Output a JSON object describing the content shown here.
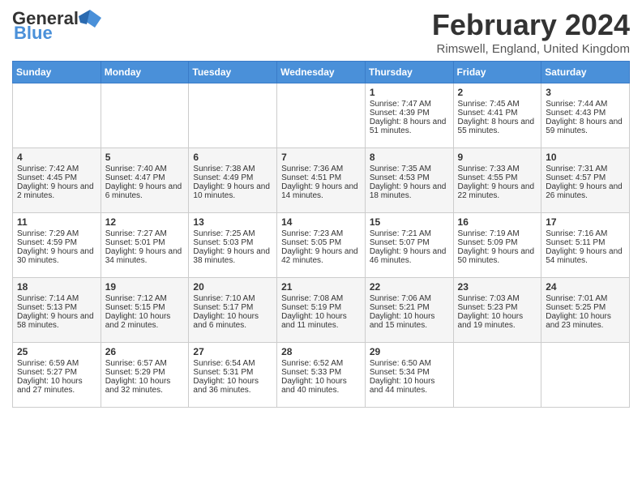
{
  "header": {
    "logo_general": "General",
    "logo_blue": "Blue",
    "month_title": "February 2024",
    "location": "Rimswell, England, United Kingdom"
  },
  "weekdays": [
    "Sunday",
    "Monday",
    "Tuesday",
    "Wednesday",
    "Thursday",
    "Friday",
    "Saturday"
  ],
  "weeks": [
    [
      {
        "day": "",
        "sunrise": "",
        "sunset": "",
        "daylight": ""
      },
      {
        "day": "",
        "sunrise": "",
        "sunset": "",
        "daylight": ""
      },
      {
        "day": "",
        "sunrise": "",
        "sunset": "",
        "daylight": ""
      },
      {
        "day": "",
        "sunrise": "",
        "sunset": "",
        "daylight": ""
      },
      {
        "day": "1",
        "sunrise": "Sunrise: 7:47 AM",
        "sunset": "Sunset: 4:39 PM",
        "daylight": "Daylight: 8 hours and 51 minutes."
      },
      {
        "day": "2",
        "sunrise": "Sunrise: 7:45 AM",
        "sunset": "Sunset: 4:41 PM",
        "daylight": "Daylight: 8 hours and 55 minutes."
      },
      {
        "day": "3",
        "sunrise": "Sunrise: 7:44 AM",
        "sunset": "Sunset: 4:43 PM",
        "daylight": "Daylight: 8 hours and 59 minutes."
      }
    ],
    [
      {
        "day": "4",
        "sunrise": "Sunrise: 7:42 AM",
        "sunset": "Sunset: 4:45 PM",
        "daylight": "Daylight: 9 hours and 2 minutes."
      },
      {
        "day": "5",
        "sunrise": "Sunrise: 7:40 AM",
        "sunset": "Sunset: 4:47 PM",
        "daylight": "Daylight: 9 hours and 6 minutes."
      },
      {
        "day": "6",
        "sunrise": "Sunrise: 7:38 AM",
        "sunset": "Sunset: 4:49 PM",
        "daylight": "Daylight: 9 hours and 10 minutes."
      },
      {
        "day": "7",
        "sunrise": "Sunrise: 7:36 AM",
        "sunset": "Sunset: 4:51 PM",
        "daylight": "Daylight: 9 hours and 14 minutes."
      },
      {
        "day": "8",
        "sunrise": "Sunrise: 7:35 AM",
        "sunset": "Sunset: 4:53 PM",
        "daylight": "Daylight: 9 hours and 18 minutes."
      },
      {
        "day": "9",
        "sunrise": "Sunrise: 7:33 AM",
        "sunset": "Sunset: 4:55 PM",
        "daylight": "Daylight: 9 hours and 22 minutes."
      },
      {
        "day": "10",
        "sunrise": "Sunrise: 7:31 AM",
        "sunset": "Sunset: 4:57 PM",
        "daylight": "Daylight: 9 hours and 26 minutes."
      }
    ],
    [
      {
        "day": "11",
        "sunrise": "Sunrise: 7:29 AM",
        "sunset": "Sunset: 4:59 PM",
        "daylight": "Daylight: 9 hours and 30 minutes."
      },
      {
        "day": "12",
        "sunrise": "Sunrise: 7:27 AM",
        "sunset": "Sunset: 5:01 PM",
        "daylight": "Daylight: 9 hours and 34 minutes."
      },
      {
        "day": "13",
        "sunrise": "Sunrise: 7:25 AM",
        "sunset": "Sunset: 5:03 PM",
        "daylight": "Daylight: 9 hours and 38 minutes."
      },
      {
        "day": "14",
        "sunrise": "Sunrise: 7:23 AM",
        "sunset": "Sunset: 5:05 PM",
        "daylight": "Daylight: 9 hours and 42 minutes."
      },
      {
        "day": "15",
        "sunrise": "Sunrise: 7:21 AM",
        "sunset": "Sunset: 5:07 PM",
        "daylight": "Daylight: 9 hours and 46 minutes."
      },
      {
        "day": "16",
        "sunrise": "Sunrise: 7:19 AM",
        "sunset": "Sunset: 5:09 PM",
        "daylight": "Daylight: 9 hours and 50 minutes."
      },
      {
        "day": "17",
        "sunrise": "Sunrise: 7:16 AM",
        "sunset": "Sunset: 5:11 PM",
        "daylight": "Daylight: 9 hours and 54 minutes."
      }
    ],
    [
      {
        "day": "18",
        "sunrise": "Sunrise: 7:14 AM",
        "sunset": "Sunset: 5:13 PM",
        "daylight": "Daylight: 9 hours and 58 minutes."
      },
      {
        "day": "19",
        "sunrise": "Sunrise: 7:12 AM",
        "sunset": "Sunset: 5:15 PM",
        "daylight": "Daylight: 10 hours and 2 minutes."
      },
      {
        "day": "20",
        "sunrise": "Sunrise: 7:10 AM",
        "sunset": "Sunset: 5:17 PM",
        "daylight": "Daylight: 10 hours and 6 minutes."
      },
      {
        "day": "21",
        "sunrise": "Sunrise: 7:08 AM",
        "sunset": "Sunset: 5:19 PM",
        "daylight": "Daylight: 10 hours and 11 minutes."
      },
      {
        "day": "22",
        "sunrise": "Sunrise: 7:06 AM",
        "sunset": "Sunset: 5:21 PM",
        "daylight": "Daylight: 10 hours and 15 minutes."
      },
      {
        "day": "23",
        "sunrise": "Sunrise: 7:03 AM",
        "sunset": "Sunset: 5:23 PM",
        "daylight": "Daylight: 10 hours and 19 minutes."
      },
      {
        "day": "24",
        "sunrise": "Sunrise: 7:01 AM",
        "sunset": "Sunset: 5:25 PM",
        "daylight": "Daylight: 10 hours and 23 minutes."
      }
    ],
    [
      {
        "day": "25",
        "sunrise": "Sunrise: 6:59 AM",
        "sunset": "Sunset: 5:27 PM",
        "daylight": "Daylight: 10 hours and 27 minutes."
      },
      {
        "day": "26",
        "sunrise": "Sunrise: 6:57 AM",
        "sunset": "Sunset: 5:29 PM",
        "daylight": "Daylight: 10 hours and 32 minutes."
      },
      {
        "day": "27",
        "sunrise": "Sunrise: 6:54 AM",
        "sunset": "Sunset: 5:31 PM",
        "daylight": "Daylight: 10 hours and 36 minutes."
      },
      {
        "day": "28",
        "sunrise": "Sunrise: 6:52 AM",
        "sunset": "Sunset: 5:33 PM",
        "daylight": "Daylight: 10 hours and 40 minutes."
      },
      {
        "day": "29",
        "sunrise": "Sunrise: 6:50 AM",
        "sunset": "Sunset: 5:34 PM",
        "daylight": "Daylight: 10 hours and 44 minutes."
      },
      {
        "day": "",
        "sunrise": "",
        "sunset": "",
        "daylight": ""
      },
      {
        "day": "",
        "sunrise": "",
        "sunset": "",
        "daylight": ""
      }
    ]
  ]
}
